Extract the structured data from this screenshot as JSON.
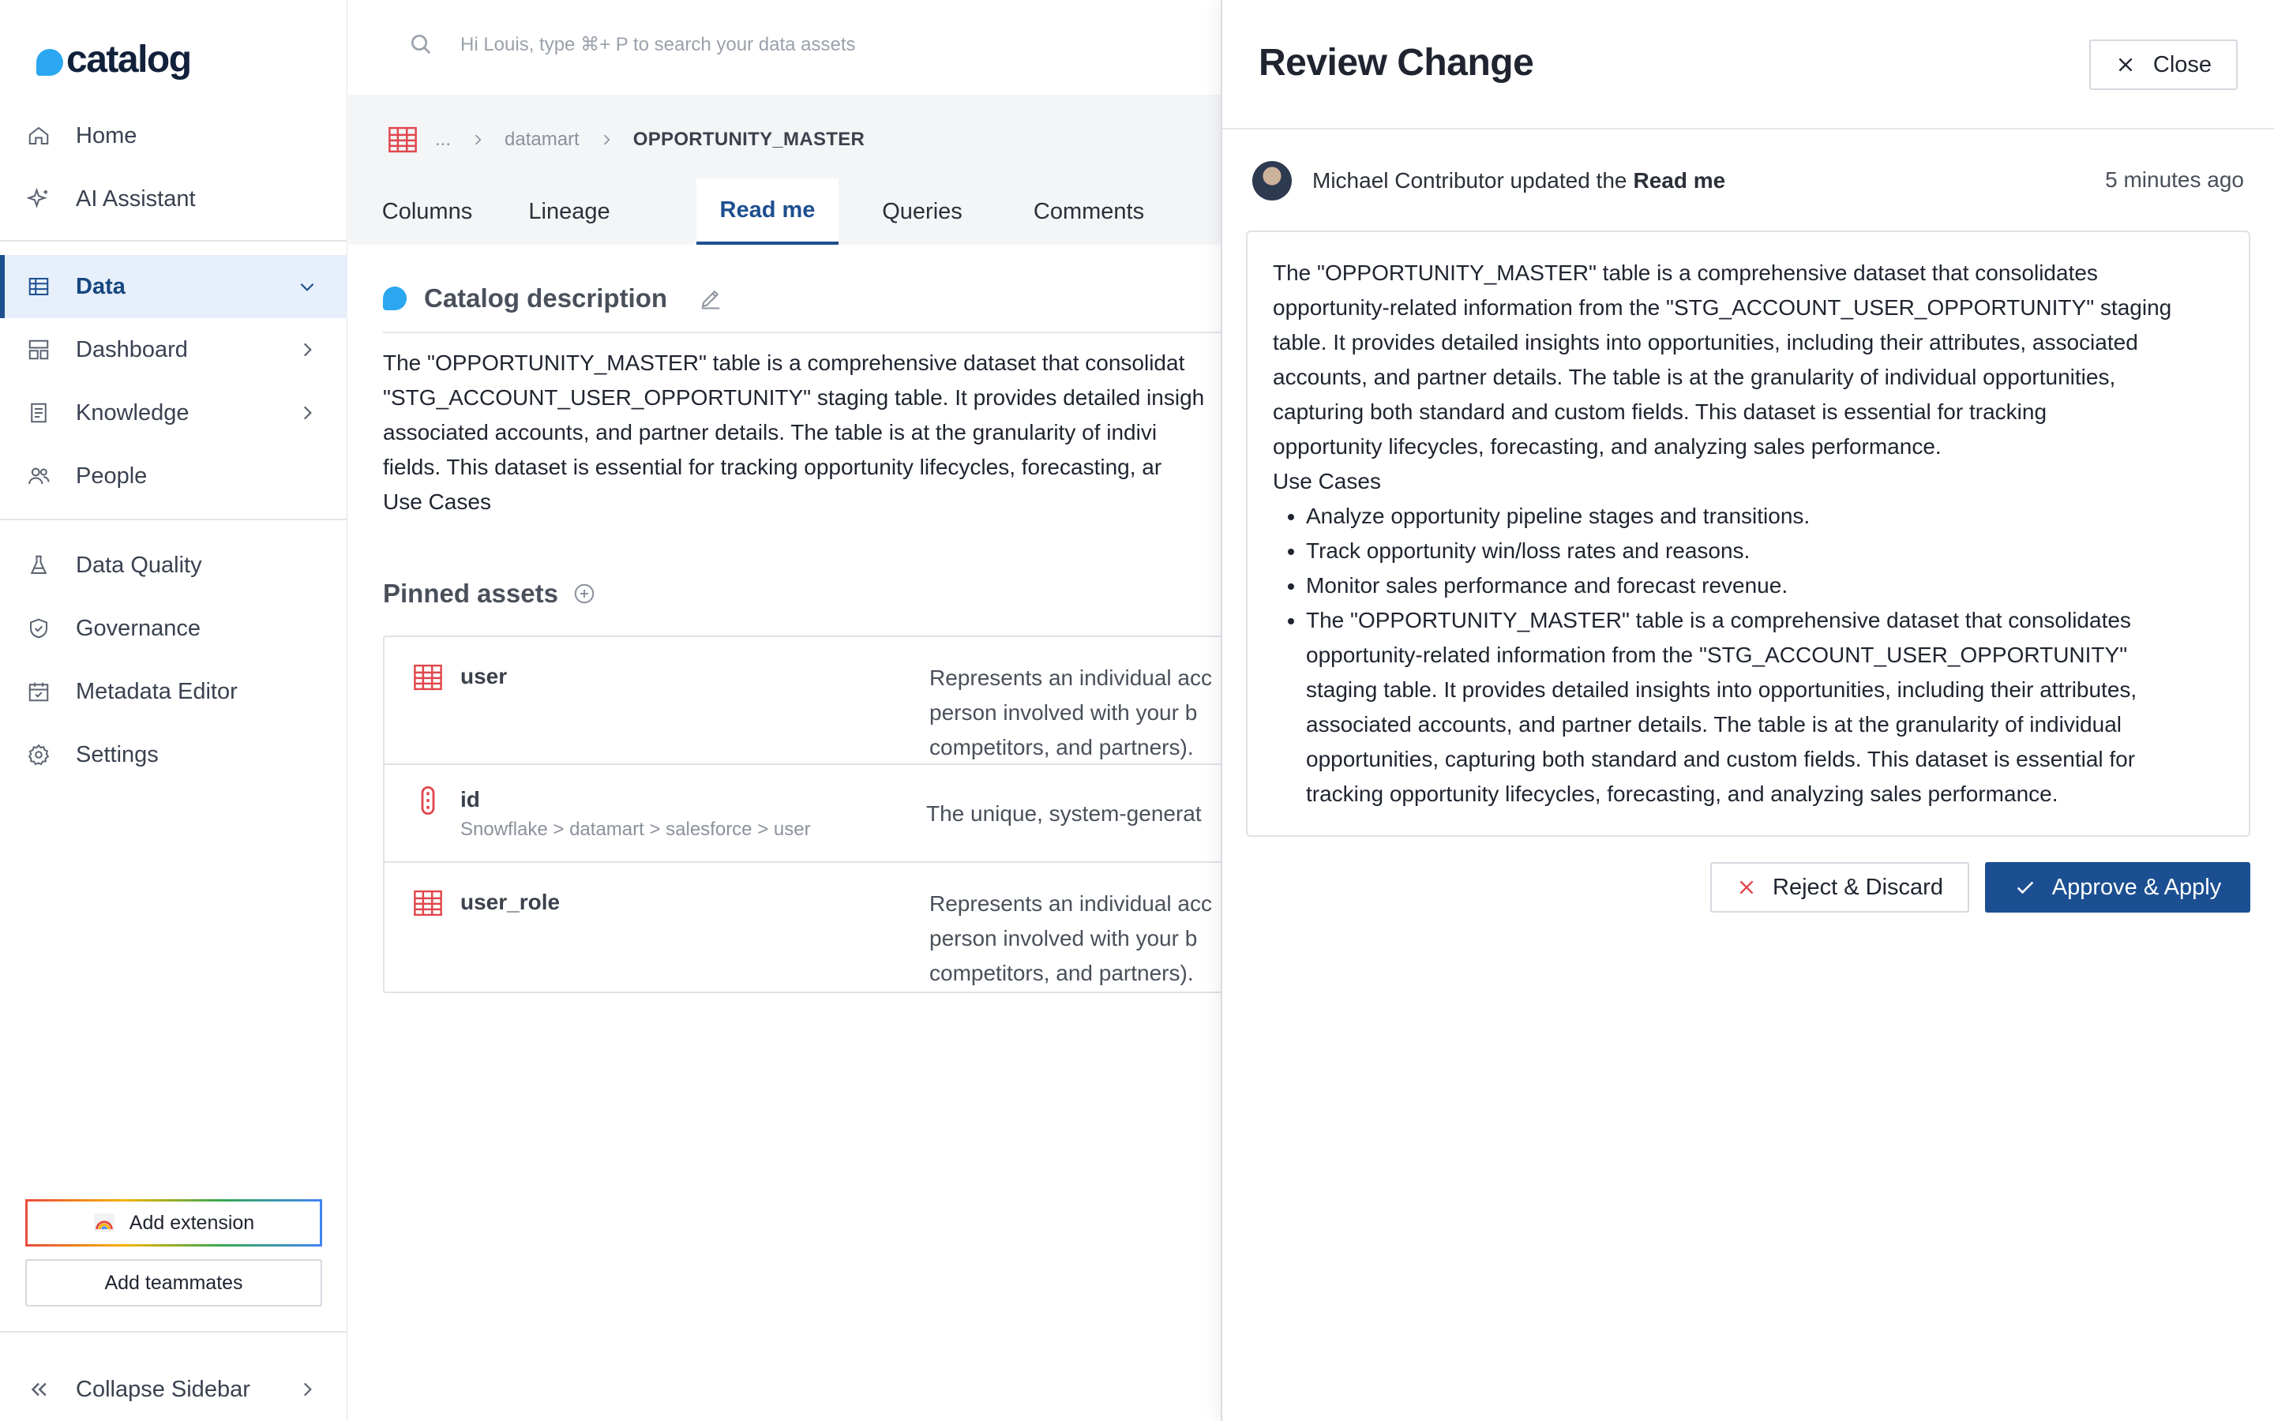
{
  "app": {
    "logo_text": "catalog"
  },
  "sidebar": {
    "items": [
      {
        "label": "Home",
        "icon": "home-icon"
      },
      {
        "label": "AI Assistant",
        "icon": "sparkle-icon"
      },
      {
        "label": "Data",
        "icon": "table-icon",
        "active": true,
        "expanded": true
      },
      {
        "label": "Dashboard",
        "icon": "dashboard-icon"
      },
      {
        "label": "Knowledge",
        "icon": "book-icon"
      },
      {
        "label": "People",
        "icon": "people-icon"
      },
      {
        "label": "Data Quality",
        "icon": "flask-icon"
      },
      {
        "label": "Governance",
        "icon": "shield-icon"
      },
      {
        "label": "Metadata Editor",
        "icon": "calendar-check-icon"
      },
      {
        "label": "Settings",
        "icon": "gear-icon"
      }
    ],
    "add_extension": "Add extension",
    "add_teammates": "Add teammates",
    "collapse": "Collapse Sidebar"
  },
  "search": {
    "placeholder": "Hi Louis, type  ⌘+ P to search your data assets"
  },
  "breadcrumb": {
    "ellipsis": "...",
    "parent": "datamart",
    "current": "OPPORTUNITY_MASTER"
  },
  "tabs": [
    {
      "label": "Columns"
    },
    {
      "label": "Lineage"
    },
    {
      "label": "Read me",
      "active": true
    },
    {
      "label": "Queries"
    },
    {
      "label": "Comments"
    }
  ],
  "catalog_description": {
    "title": "Catalog description",
    "lines": [
      "The \"OPPORTUNITY_MASTER\" table is a comprehensive dataset that consolidat",
      "\"STG_ACCOUNT_USER_OPPORTUNITY\" staging table. It provides detailed insigh",
      "associated accounts, and partner details. The table is at the granularity of indivi",
      "fields. This dataset is essential for tracking opportunity lifecycles, forecasting, ar",
      "Use Cases"
    ]
  },
  "pinned_assets": {
    "title": "Pinned assets",
    "rows": [
      {
        "name": "user",
        "path": "",
        "icon": "table-icon",
        "desc": [
          "Represents an individual acc",
          "person involved with your b",
          "competitors, and partners)."
        ]
      },
      {
        "name": "id",
        "path": "Snowflake > datamart > salesforce > user",
        "icon": "column-icon",
        "desc": [
          "The unique, system-generat"
        ]
      },
      {
        "name": "user_role",
        "path": "",
        "icon": "table-icon",
        "desc": [
          "Represents an individual acc",
          "person involved with your b",
          "competitors, and partners)."
        ]
      }
    ]
  },
  "review": {
    "title": "Review Change",
    "close_label": "Close",
    "author": "Michael Contributor updated the",
    "target": "Read me",
    "time": "5 minutes ago",
    "paragraph_lines": [
      "The \"OPPORTUNITY_MASTER\" table is a comprehensive dataset that consolidates",
      "opportunity-related information from the \"STG_ACCOUNT_USER_OPPORTUNITY\" staging",
      "table. It provides detailed insights into opportunities, including their attributes, associated",
      "accounts, and partner details. The table is at the granularity of individual opportunities,",
      "capturing both standard and custom fields. This dataset is essential for tracking",
      "opportunity lifecycles, forecasting, and analyzing sales performance.",
      "Use Cases"
    ],
    "bullets": [
      [
        "Analyze opportunity pipeline stages and transitions."
      ],
      [
        "Track opportunity win/loss rates and reasons."
      ],
      [
        "Monitor sales performance and forecast revenue."
      ],
      [
        "The \"OPPORTUNITY_MASTER\" table is a comprehensive dataset that consolidates",
        "opportunity-related information from the \"STG_ACCOUNT_USER_OPPORTUNITY\"",
        "staging table. It provides detailed insights into opportunities, including their attributes,",
        "associated accounts, and partner details. The table is at the granularity of individual",
        "opportunities, capturing both standard and custom fields. This dataset is essential for",
        "tracking opportunity lifecycles, forecasting, and analyzing sales performance."
      ]
    ],
    "reject_label": "Reject & Discard",
    "approve_label": "Approve & Apply"
  },
  "colors": {
    "accent": "#1b4f91",
    "brand": "#2aa7f0",
    "danger": "#e0474c"
  }
}
